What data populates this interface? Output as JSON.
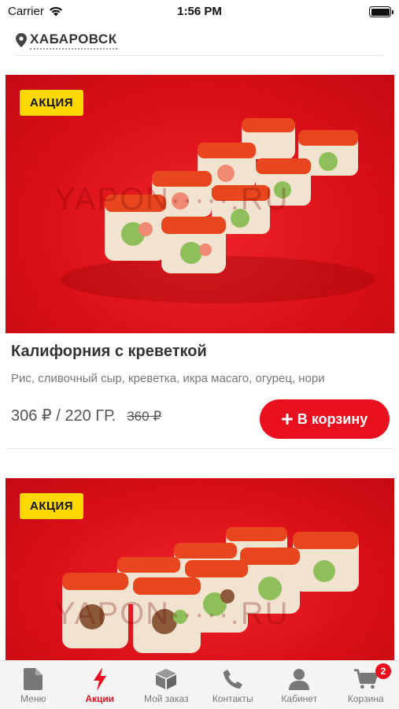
{
  "status_bar": {
    "carrier": "Carrier",
    "time": "1:56 PM"
  },
  "location": {
    "city": "ХАБАРОВСК"
  },
  "products": [
    {
      "badge": "АКЦИЯ",
      "watermark": "YAPON·····.RU",
      "title": "Калифорния с креветкой",
      "description": "Рис, сливочный сыр, креветка, икра масаго, огурец, нори",
      "price": "306 ₽ / 220 ГР.",
      "old_price": "360 ₽",
      "cart_label": "В корзину"
    },
    {
      "badge": "АКЦИЯ",
      "watermark": "YAPON·····.RU"
    }
  ],
  "tabbar": {
    "items": [
      {
        "label": "Меню",
        "icon": "document-icon"
      },
      {
        "label": "Акции",
        "icon": "lightning-icon"
      },
      {
        "label": "Мой заказ",
        "icon": "box-icon"
      },
      {
        "label": "Контакты",
        "icon": "phone-icon"
      },
      {
        "label": "Кабинет",
        "icon": "user-icon"
      },
      {
        "label": "Корзина",
        "icon": "cart-icon"
      }
    ],
    "active": "Акции",
    "cart_count": "2"
  },
  "colors": {
    "accent": "#e8101e",
    "badge": "#ffd800",
    "icon_gray": "#777777"
  }
}
